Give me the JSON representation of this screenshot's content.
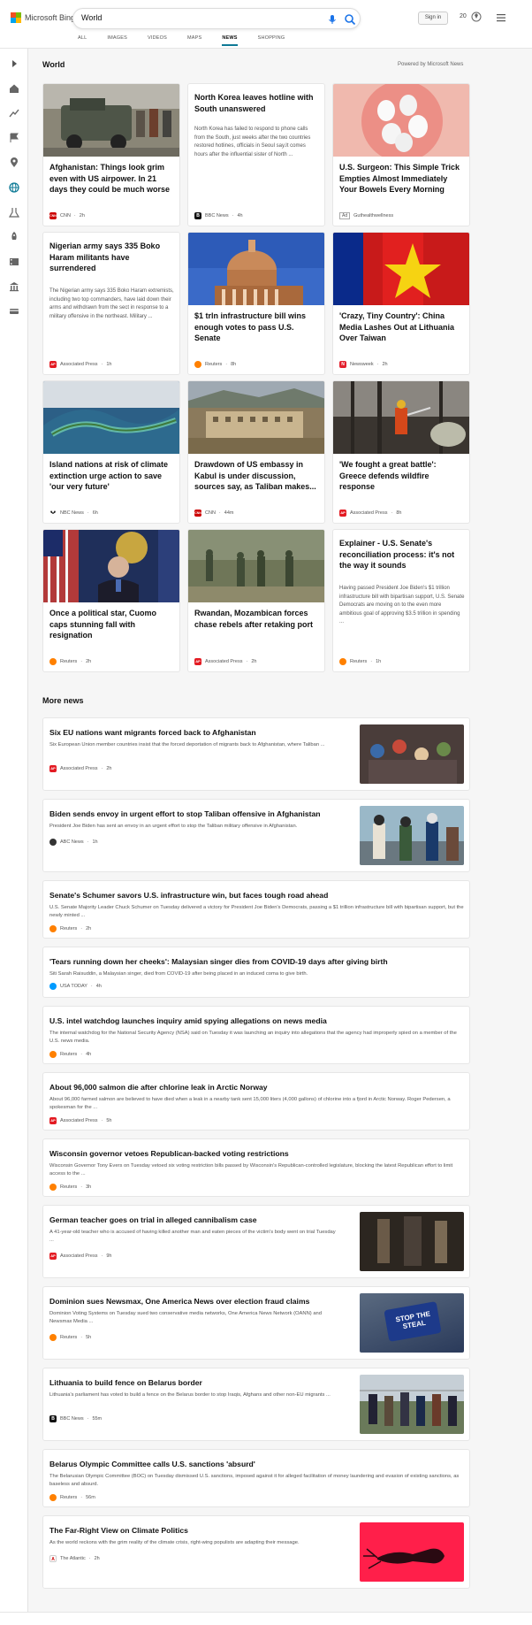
{
  "header": {
    "logo_text": "Microsoft Bing",
    "search_value": "World",
    "signin_label": "Sign in",
    "reward_count": "20",
    "tabs": [
      {
        "label": "ALL"
      },
      {
        "label": "IMAGES"
      },
      {
        "label": "VIDEOS"
      },
      {
        "label": "MAPS"
      },
      {
        "label": "NEWS"
      },
      {
        "label": "SHOPPING"
      }
    ]
  },
  "section": {
    "title": "World",
    "powered_by": "Powered by Microsoft News"
  },
  "cards": [
    {
      "headline": "Afghanistan: Things look grim even with US airpower. In 21 days they could be much worse",
      "snippet": "",
      "source": "CNN",
      "time": "2h",
      "badge_color": "#cc0000",
      "badge_text": "CNN"
    },
    {
      "headline": "North Korea leaves hotline with South unanswered",
      "snippet": "North Korea has failed to respond to phone calls from the South, just weeks after the two countries restored hotlines, officials in Seoul say.It comes hours after the influential sister of North ...",
      "source": "BBC News",
      "time": "4h",
      "badge_color": "#111111",
      "badge_text": "B"
    },
    {
      "headline": "U.S. Surgeon: This Simple Trick Empties Almost Immediately Your Bowels Every Morning",
      "snippet": "",
      "source": "Guthealthwellness",
      "time": "",
      "ad_label": "Ad",
      "badge_color": "#ffffff",
      "badge_text": ""
    },
    {
      "headline": "Nigerian army says 335 Boko Haram militants have surrendered",
      "snippet": "The Nigerian army says 335 Boko Haram extremists, including two top commanders, have laid down their arms and withdrawn from the sect in response to a military offensive in the northeast. Military ...",
      "source": "Associated Press",
      "time": "1h",
      "badge_color": "#e31b23",
      "badge_text": "AP"
    },
    {
      "headline": "$1 trln infrastructure bill wins enough votes to pass U.S. Senate",
      "snippet": "",
      "source": "Reuters",
      "time": "8h",
      "badge_color": "#ff8000",
      "badge_text": ""
    },
    {
      "headline": "'Crazy, Tiny Country': China Media Lashes Out at Lithuania Over Taiwan",
      "snippet": "",
      "source": "Newsweek",
      "time": "2h",
      "badge_color": "#e3202d",
      "badge_text": "N"
    },
    {
      "headline": "Island nations at risk of climate extinction urge action to save 'our very future'",
      "snippet": "",
      "source": "NBC News",
      "time": "6h",
      "badge_color": "#111111",
      "badge_text": ""
    },
    {
      "headline": "Drawdown of US embassy in Kabul is under discussion, sources say, as Taliban makes...",
      "snippet": "",
      "source": "CNN",
      "time": "44m",
      "badge_color": "#cc0000",
      "badge_text": "CNN"
    },
    {
      "headline": "'We fought a great battle': Greece defends wildfire response",
      "snippet": "",
      "source": "Associated Press",
      "time": "8h",
      "badge_color": "#e31b23",
      "badge_text": "AP"
    },
    {
      "headline": "Once a political star, Cuomo caps stunning fall with resignation",
      "snippet": "",
      "source": "Reuters",
      "time": "2h",
      "badge_color": "#ff8000",
      "badge_text": ""
    },
    {
      "headline": "Rwandan, Mozambican forces chase rebels after retaking port",
      "snippet": "",
      "source": "Associated Press",
      "time": "2h",
      "badge_color": "#e31b23",
      "badge_text": "AP"
    },
    {
      "headline": "Explainer - U.S. Senate's reconciliation process: it's not the way it sounds",
      "snippet": "Having passed President Joe Biden's $1 trillion infrastructure bill with bipartisan support, U.S. Senate Democrats are moving on to the even more ambitious goal of approving $3.5 trillion in spending ...",
      "source": "Reuters",
      "time": "1h",
      "badge_color": "#ff8000",
      "badge_text": ""
    }
  ],
  "more": {
    "title": "More news",
    "items": [
      {
        "headline": "Six EU nations want migrants forced back to Afghanistan",
        "snippet": "Six European Union member countries insist that the forced deportation of migrants back to Afghanistan, where Taliban ...",
        "source": "Associated Press",
        "time": "2h",
        "badge_color": "#e31b23",
        "badge_text": "AP"
      },
      {
        "headline": "Biden sends envoy in urgent effort to stop Taliban offensive in Afghanistan",
        "snippet": "President Joe Biden has sent an envoy in an urgent effort to stop the Taliban military offensive in Afghanistan.",
        "source": "ABC News",
        "time": "1h",
        "badge_color": "#333333",
        "badge_text": ""
      },
      {
        "headline": "Senate's Schumer savors U.S. infrastructure win, but faces tough road ahead",
        "snippet": "U.S. Senate Majority Leader Chuck Schumer on Tuesday delivered a victory for President Joe Biden's Democrats, passing a $1 trillion infrastructure bill with bipartisan support, but the newly minted ...",
        "source": "Reuters",
        "time": "2h",
        "badge_color": "#ff8000",
        "badge_text": ""
      },
      {
        "headline": "'Tears running down her cheeks': Malaysian singer dies from COVID-19 days after giving birth",
        "snippet": "Siti Sarah Raisuddin, a Malaysian singer, died from COVID-19 after being placed in an induced coma to give birth.",
        "source": "USA TODAY",
        "time": "4h",
        "badge_color": "#009bff",
        "badge_text": ""
      },
      {
        "headline": "U.S. intel watchdog launches inquiry amid spying allegations on news media",
        "snippet": "The internal watchdog for the National Security Agency (NSA) said on Tuesday it was launching an inquiry into allegations that the agency had improperly spied on a member of the U.S. news media.",
        "source": "Reuters",
        "time": "4h",
        "badge_color": "#ff8000",
        "badge_text": ""
      },
      {
        "headline": "About 96,000 salmon die after chlorine leak in Arctic Norway",
        "snippet": "About 96,000 farmed salmon are believed to have died when a leak in a nearby tank sent 15,000 liters (4,000 gallons) of chlorine into a fjord in Arctic Norway. Roger Pedersen, a spokesman for the ...",
        "source": "Associated Press",
        "time": "5h",
        "badge_color": "#e31b23",
        "badge_text": "AP"
      },
      {
        "headline": "Wisconsin governor vetoes Republican-backed voting restrictions",
        "snippet": "Wisconsin Governor Tony Evers on Tuesday vetoed six voting restriction bills passed by Wisconsin's Republican-controlled legislature, blocking the latest Republican effort to limit access to the ...",
        "source": "Reuters",
        "time": "3h",
        "badge_color": "#ff8000",
        "badge_text": ""
      },
      {
        "headline": "German teacher goes on trial in alleged cannibalism case",
        "snippet": "A 41-year-old teacher who is accused of having killed another man and eaten pieces of the victim's body went on trial Tuesday ...",
        "source": "Associated Press",
        "time": "9h",
        "badge_color": "#e31b23",
        "badge_text": "AP"
      },
      {
        "headline": "Dominion sues Newsmax, One America News over election fraud claims",
        "snippet": "Dominion Voting Systems on Tuesday sued two conservative media networks, One America News Network (OANN) and Newsmax Media ...",
        "source": "Reuters",
        "time": "5h",
        "badge_color": "#ff8000",
        "badge_text": "",
        "thumb_text": "STOP THE STEAL"
      },
      {
        "headline": "Lithuania to build fence on Belarus border",
        "snippet": "Lithuania's parliament has voted to build a fence on the Belarus border to stop Iraqis, Afghans and other non-EU migrants ...",
        "source": "BBC News",
        "time": "55m",
        "badge_color": "#111111",
        "badge_text": "B"
      },
      {
        "headline": "Belarus Olympic Committee calls U.S. sanctions 'absurd'",
        "snippet": "The Belarusian Olympic Committee (BOC) on Tuesday dismissed U.S. sanctions, imposed against it for alleged facilitation of money laundering and evasion of existing sanctions, as baseless and absurd.",
        "source": "Reuters",
        "time": "56m",
        "badge_color": "#ff8000",
        "badge_text": ""
      },
      {
        "headline": "The Far-Right View on Climate Politics",
        "snippet": "As the world reckons with the grim reality of the climate crisis, right-wing populists are adapting their message.",
        "source": "The Atlantic",
        "time": "2h",
        "badge_color": "#ffffff",
        "badge_text": "A"
      }
    ]
  },
  "colors": {
    "accent": "#0e7a96",
    "link_blue": "#1a73e8"
  }
}
